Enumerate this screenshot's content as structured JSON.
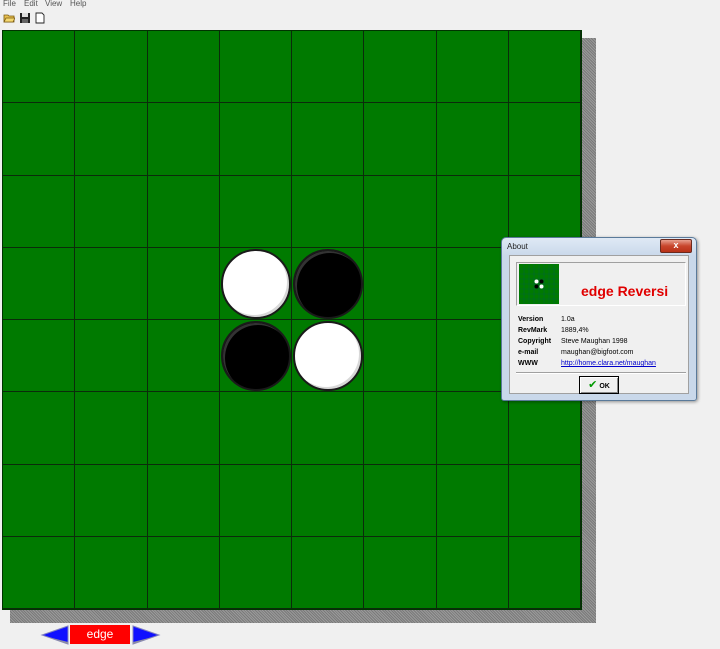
{
  "menu": [
    "File",
    "Edit",
    "View",
    "Help"
  ],
  "toolbar": {
    "icons": [
      "open-folder-icon",
      "save-disk-icon",
      "new-document-icon"
    ]
  },
  "board": {
    "size": 8,
    "color": "#007a00",
    "discs": [
      {
        "row": 3,
        "col": 3,
        "color": "white"
      },
      {
        "row": 3,
        "col": 4,
        "color": "black"
      },
      {
        "row": 4,
        "col": 3,
        "color": "black"
      },
      {
        "row": 4,
        "col": 4,
        "color": "white"
      }
    ]
  },
  "footer": {
    "label": "edge",
    "accent": "#ff0000",
    "arrow_color": "#1a1aff"
  },
  "dialog": {
    "title": "About",
    "close_label": "x",
    "app_name": "edge Reversi",
    "info": [
      {
        "key": "Version",
        "value": "1.0a"
      },
      {
        "key": "RevMark",
        "value": "1889,4%"
      },
      {
        "key": "Copyright",
        "value": "Steve Maughan 1998"
      },
      {
        "key": "e-mail",
        "value": "maughan@bigfoot.com"
      },
      {
        "key": "WWW",
        "value": "http://home.clara.net/maughan"
      }
    ],
    "ok_label": "OK"
  }
}
